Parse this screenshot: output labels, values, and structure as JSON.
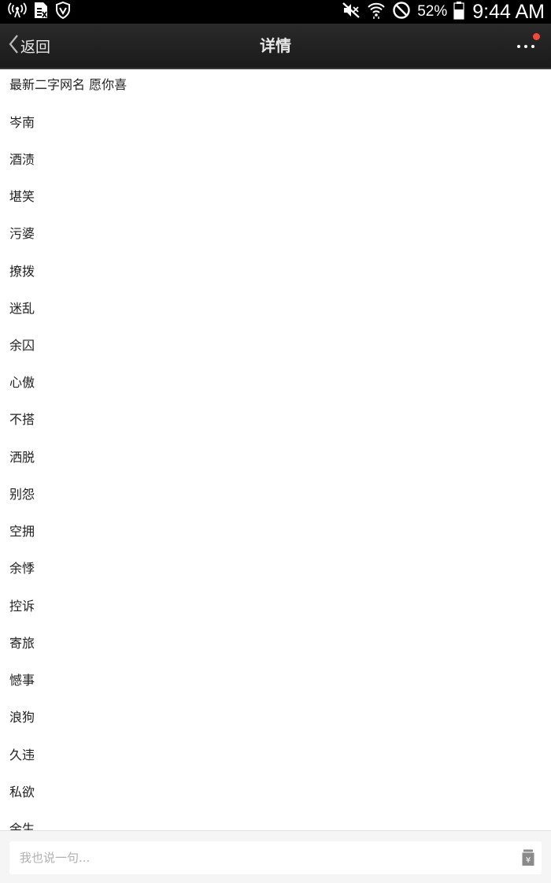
{
  "status_bar": {
    "battery_percent": "52%",
    "time": "9:44 AM",
    "icons": [
      "wireless-hotspot-icon",
      "sim-card-icon",
      "shield-icon",
      "mute-icon",
      "wifi-icon",
      "do-not-disturb-icon",
      "battery-icon"
    ]
  },
  "nav": {
    "back_label": "返回",
    "title": "详情",
    "has_notification_dot": true,
    "accent_dot_color": "#f04a3a"
  },
  "content": {
    "title": "最新二字网名 愿你喜",
    "names": [
      "岑南",
      "酒渍",
      "堪笑",
      "污婆",
      "撩拨",
      "迷乱",
      "余囚",
      "心傲",
      "不搭",
      "洒脱",
      "别怨",
      "空拥",
      "余悸",
      "控诉",
      "寄旅",
      "憾事",
      "浪狗",
      "久违",
      "私欲",
      "余生"
    ]
  },
  "comment_bar": {
    "placeholder": "我也说一句...",
    "reward_icon": "reward-yen-icon"
  }
}
